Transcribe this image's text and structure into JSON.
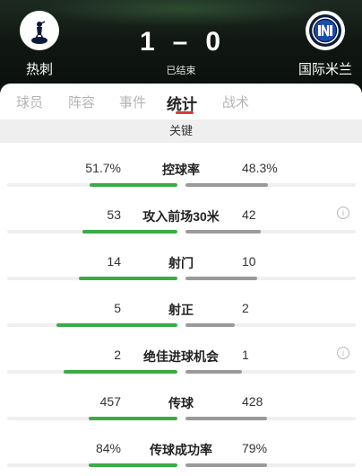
{
  "match": {
    "home_team": "热刺",
    "away_team": "国际米兰",
    "home_score": "1",
    "away_score": "0",
    "separator": "–",
    "status": "已结束",
    "home_crest_icon": "tottenham-crest-icon",
    "away_crest_icon": "inter-crest-icon"
  },
  "tabs": [
    {
      "label": "球员",
      "active": false
    },
    {
      "label": "阵容",
      "active": false
    },
    {
      "label": "事件",
      "active": false
    },
    {
      "label": "统计",
      "active": true
    },
    {
      "label": "战术",
      "active": false
    }
  ],
  "section": {
    "title": "关键"
  },
  "colors": {
    "home_bar": "#3aac45",
    "away_bar": "#9a9a9a",
    "tab_accent": "#d93a3a"
  },
  "stats": [
    {
      "label": "控球率",
      "home": "51.7%",
      "away": "48.3%",
      "home_share": 0.517,
      "away_share": 0.483,
      "info": false
    },
    {
      "label": "攻入前场30米",
      "home": "53",
      "away": "42",
      "home_share": 0.56,
      "away_share": 0.44,
      "info": true
    },
    {
      "label": "射门",
      "home": "14",
      "away": "10",
      "home_share": 0.58,
      "away_share": 0.42,
      "info": false
    },
    {
      "label": "射正",
      "home": "5",
      "away": "2",
      "home_share": 0.71,
      "away_share": 0.29,
      "info": false
    },
    {
      "label": "绝佳进球机会",
      "home": "2",
      "away": "1",
      "home_share": 0.67,
      "away_share": 0.33,
      "info": true
    },
    {
      "label": "传球",
      "home": "457",
      "away": "428",
      "home_share": 0.52,
      "away_share": 0.48,
      "info": false
    },
    {
      "label": "传球成功率",
      "home": "84%",
      "away": "79%",
      "home_share": 0.52,
      "away_share": 0.48,
      "info": false
    }
  ]
}
